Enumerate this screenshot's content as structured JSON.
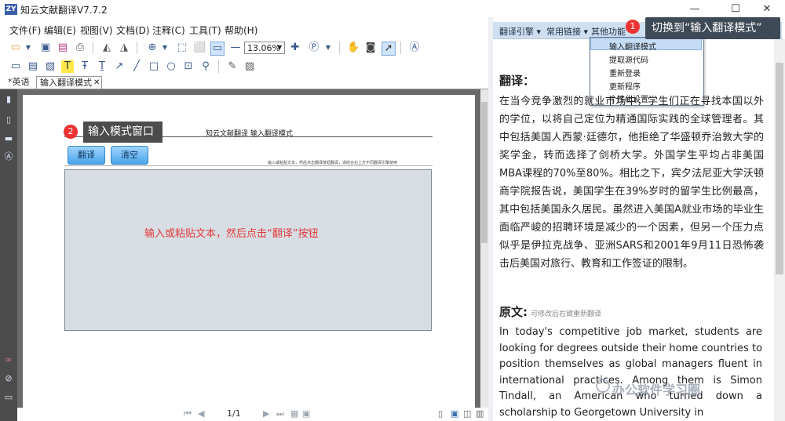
{
  "app": {
    "title": "知云文献翻译V7.7.2",
    "logo": "ZY",
    "window_controls": [
      "—",
      "☐",
      "✕"
    ]
  },
  "menu": [
    "文件(F)",
    "编辑(E)",
    "视图(V)",
    "文档(D)",
    "注释(C)",
    "工具(T)",
    "帮助(H)"
  ],
  "toolbar": {
    "zoom": "13.06%"
  },
  "tabs": [
    {
      "label": "*英语",
      "active": false
    },
    {
      "label": "输入翻译模式",
      "active": true,
      "close": "✕"
    }
  ],
  "doc": {
    "header": "知云文献翻译  输入翻译模式",
    "hint": "输入或粘贴文本，然后点击翻译按钮翻译，请结合右上方不同翻译引擎使用",
    "translate_btn": "翻译",
    "clear_btn": "清空",
    "placeholder": "输入或粘贴文本，然后点击“翻译”按钮"
  },
  "callouts": {
    "one": {
      "num": "1",
      "text": "切换到“输入翻译模式”"
    },
    "two": {
      "num": "2",
      "text": "输入模式窗口"
    }
  },
  "pager": {
    "page": "1/1"
  },
  "right_toolbar": {
    "engine": "翻译引擎",
    "links": "常用链接",
    "other": "其他功能"
  },
  "dropdown": [
    "输入翻译模式",
    "提取源代码",
    "重新登录",
    "更新程序",
    "个性化设置"
  ],
  "translation": {
    "title": "翻译：",
    "text": "在当今竞争激烈的就业市场中，学生们正在寻找本国以外的学位，以将自己定位为精通国际实践的全球管理者。其中包括美国人西蒙·廷德尔，他拒绝了华盛顿乔治敦大学的奖学金，转而选择了剑桥大学。外国学生平均占非美国MBA课程的70%至80%。相比之下，宾夕法尼亚大学沃顿商学院报告说，美国学生在39%岁时的留学生比例最高，其中包括美国永久居民。虽然进入美国A就业市场的毕业生面临严峻的招聘环境是减少的一个因素，但另一个压力点似乎是伊拉克战争、亚洲SARS和2001年9月11日恐怖袭击后美国对旅行、教育和工作签证的限制。"
  },
  "original": {
    "title": "原文:",
    "hint": "可修改后右键重新翻译",
    "text": "In today's competitive job market, students are looking for degrees outside their home countries to position themselves as global managers fluent in international practices. Among them is Simon Tindall, an American who turned down a scholarship to Georgetown University in"
  },
  "watermark": "办公软件学习圈"
}
